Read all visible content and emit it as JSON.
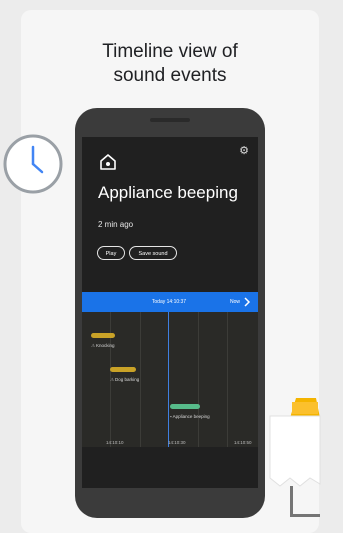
{
  "headline": {
    "line1": "Timeline view of",
    "line2": "sound events"
  },
  "notification": {
    "title": "Appliance beeping",
    "time_ago": "2 min ago",
    "play_label": "Play",
    "save_label": "Save sound"
  },
  "timeline": {
    "center_text": "Today 14:10:37",
    "now_label": "Now",
    "events": [
      {
        "label": "Knocking",
        "color": "#c9a227"
      },
      {
        "label": "Dog barking",
        "color": "#c9a227"
      },
      {
        "label": "Appliance beeping",
        "color": "#57bb8a"
      }
    ],
    "ticks": [
      "14:10:10",
      "14:10:30",
      "14:10:50"
    ]
  },
  "colors": {
    "accent_blue": "#1a73e8",
    "event_yellow": "#c9a227",
    "event_green": "#57bb8a"
  },
  "icons": {
    "home": "home-sound-icon",
    "settings": "gear-icon",
    "chevron": "chevron-right-icon",
    "clock": "clock-icon"
  }
}
